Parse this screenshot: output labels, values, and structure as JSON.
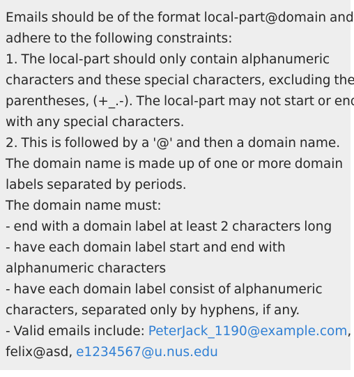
{
  "help_text": {
    "lines": [
      "Emails should be of the format local-part@domain and",
      "adhere to the following constraints:",
      "1. The local-part should only contain alphanumeric",
      "characters and these special characters, excluding the",
      "parentheses, (+_.-). The local-part may not start or end",
      "with any special characters.",
      "2. This is followed by a '@' and then a domain name.",
      "The domain name is made up of one or more domain",
      "labels separated by periods.",
      "The domain name must:",
      "- end with a domain label at least 2 characters long",
      "- have each domain label start and end with",
      "alphanumeric characters",
      "- have each domain label consist of alphanumeric",
      "characters, separated only by hyphens, if any."
    ],
    "examples": {
      "prefix": "- Valid emails include: ",
      "example_1": "PeterJack_1190@example.com",
      "separator_1": ",",
      "example_2": "felix@asd",
      "separator_2": ", ",
      "example_3": "e1234567@u.nus.edu"
    }
  },
  "colors": {
    "background": "#eeeeee",
    "text": "#262626",
    "link": "#2f7fd4"
  }
}
